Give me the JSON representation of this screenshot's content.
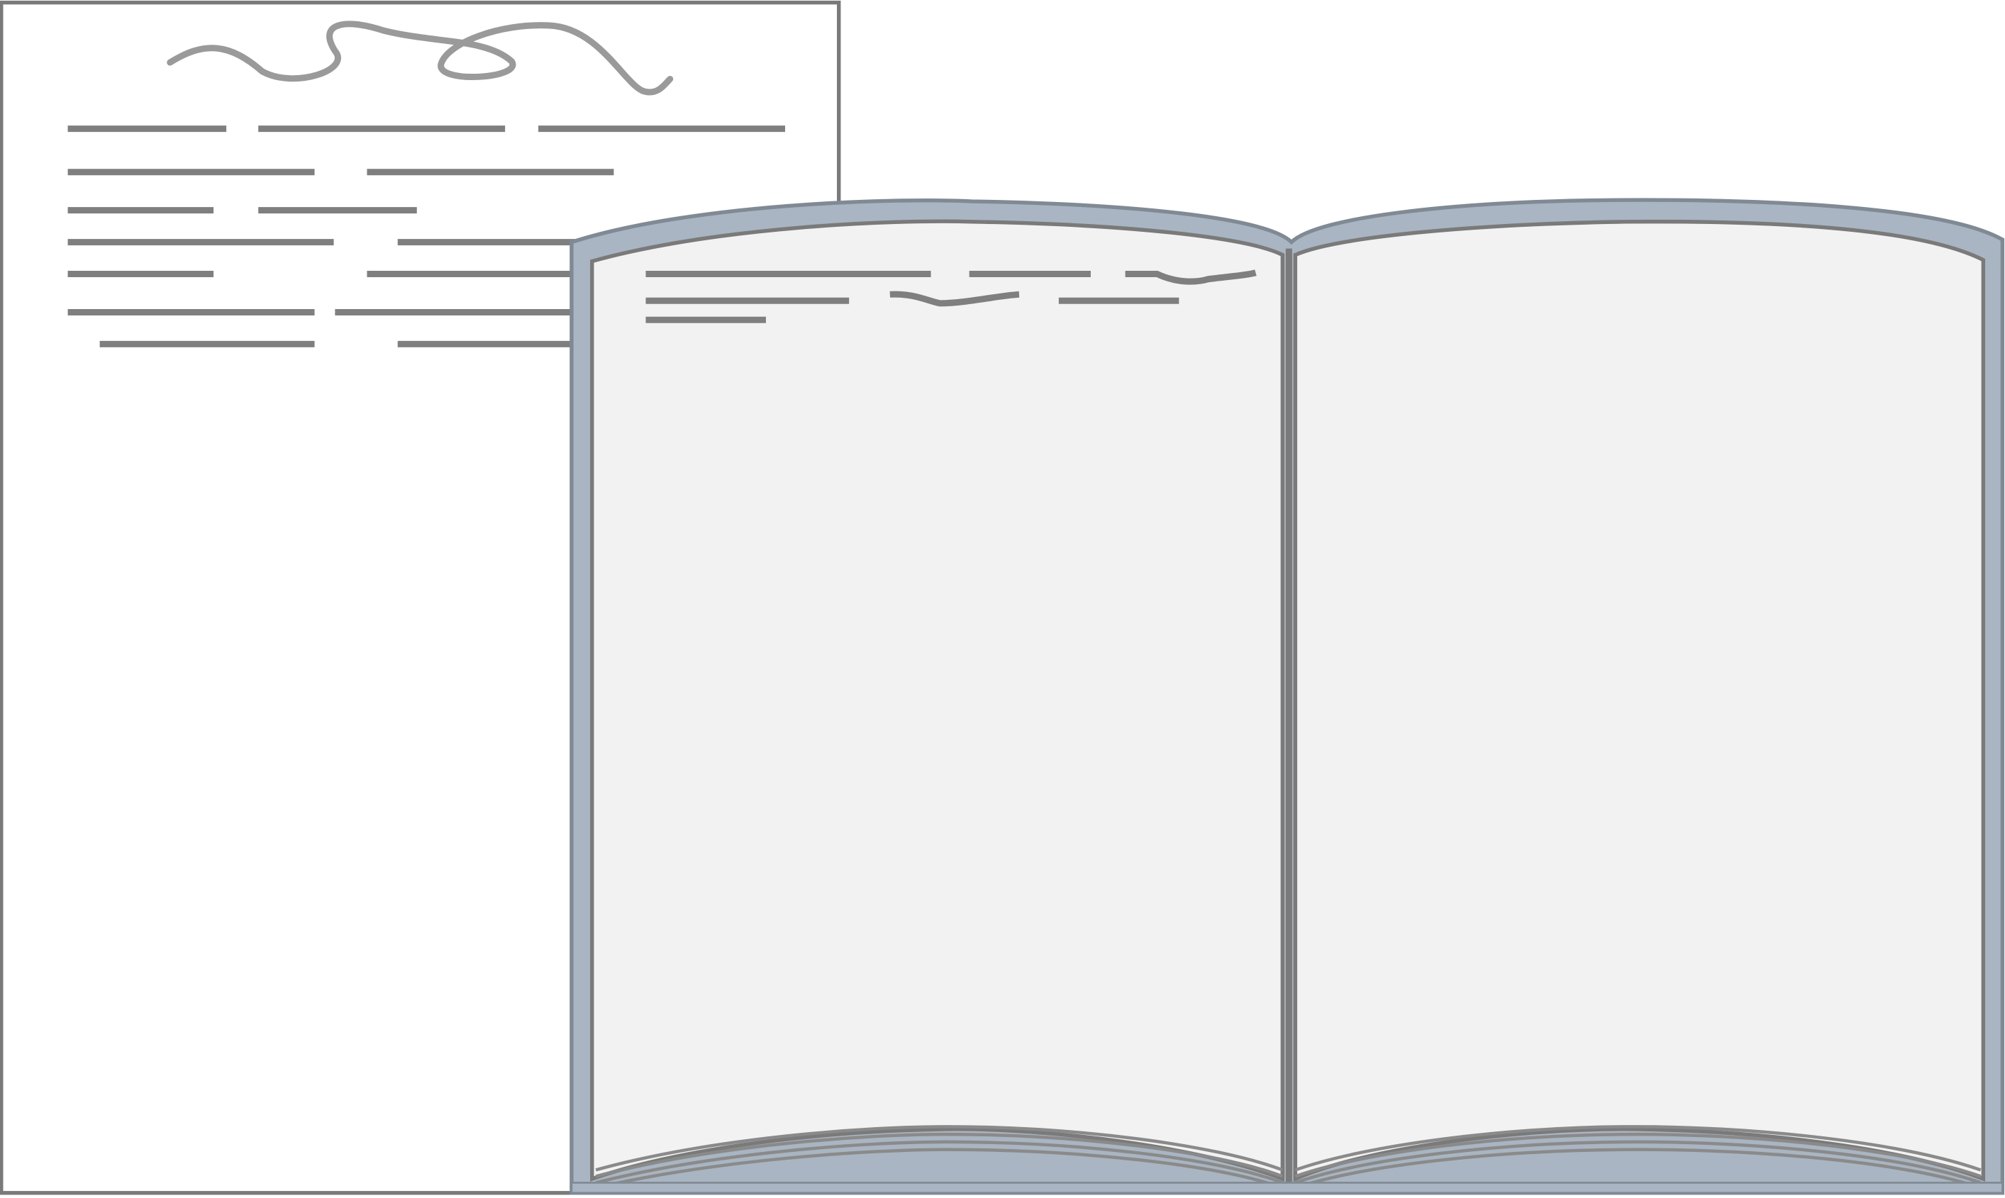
{
  "scene": {
    "description_icons": [
      "document-sheet-icon",
      "open-book-icon"
    ],
    "colors": {
      "background": "#ffffff",
      "sheet_fill": "#ffffff",
      "sheet_border": "#7a7a7a",
      "text_line": "#7f7f7f",
      "squiggle": "#9a9a9a",
      "book_cover": "#a9b5c2",
      "book_cover_outline": "#808a94",
      "book_page": "#f2f2f2",
      "book_page_border": "#7a7a7a",
      "page_edges": "#8a8a8a"
    }
  }
}
